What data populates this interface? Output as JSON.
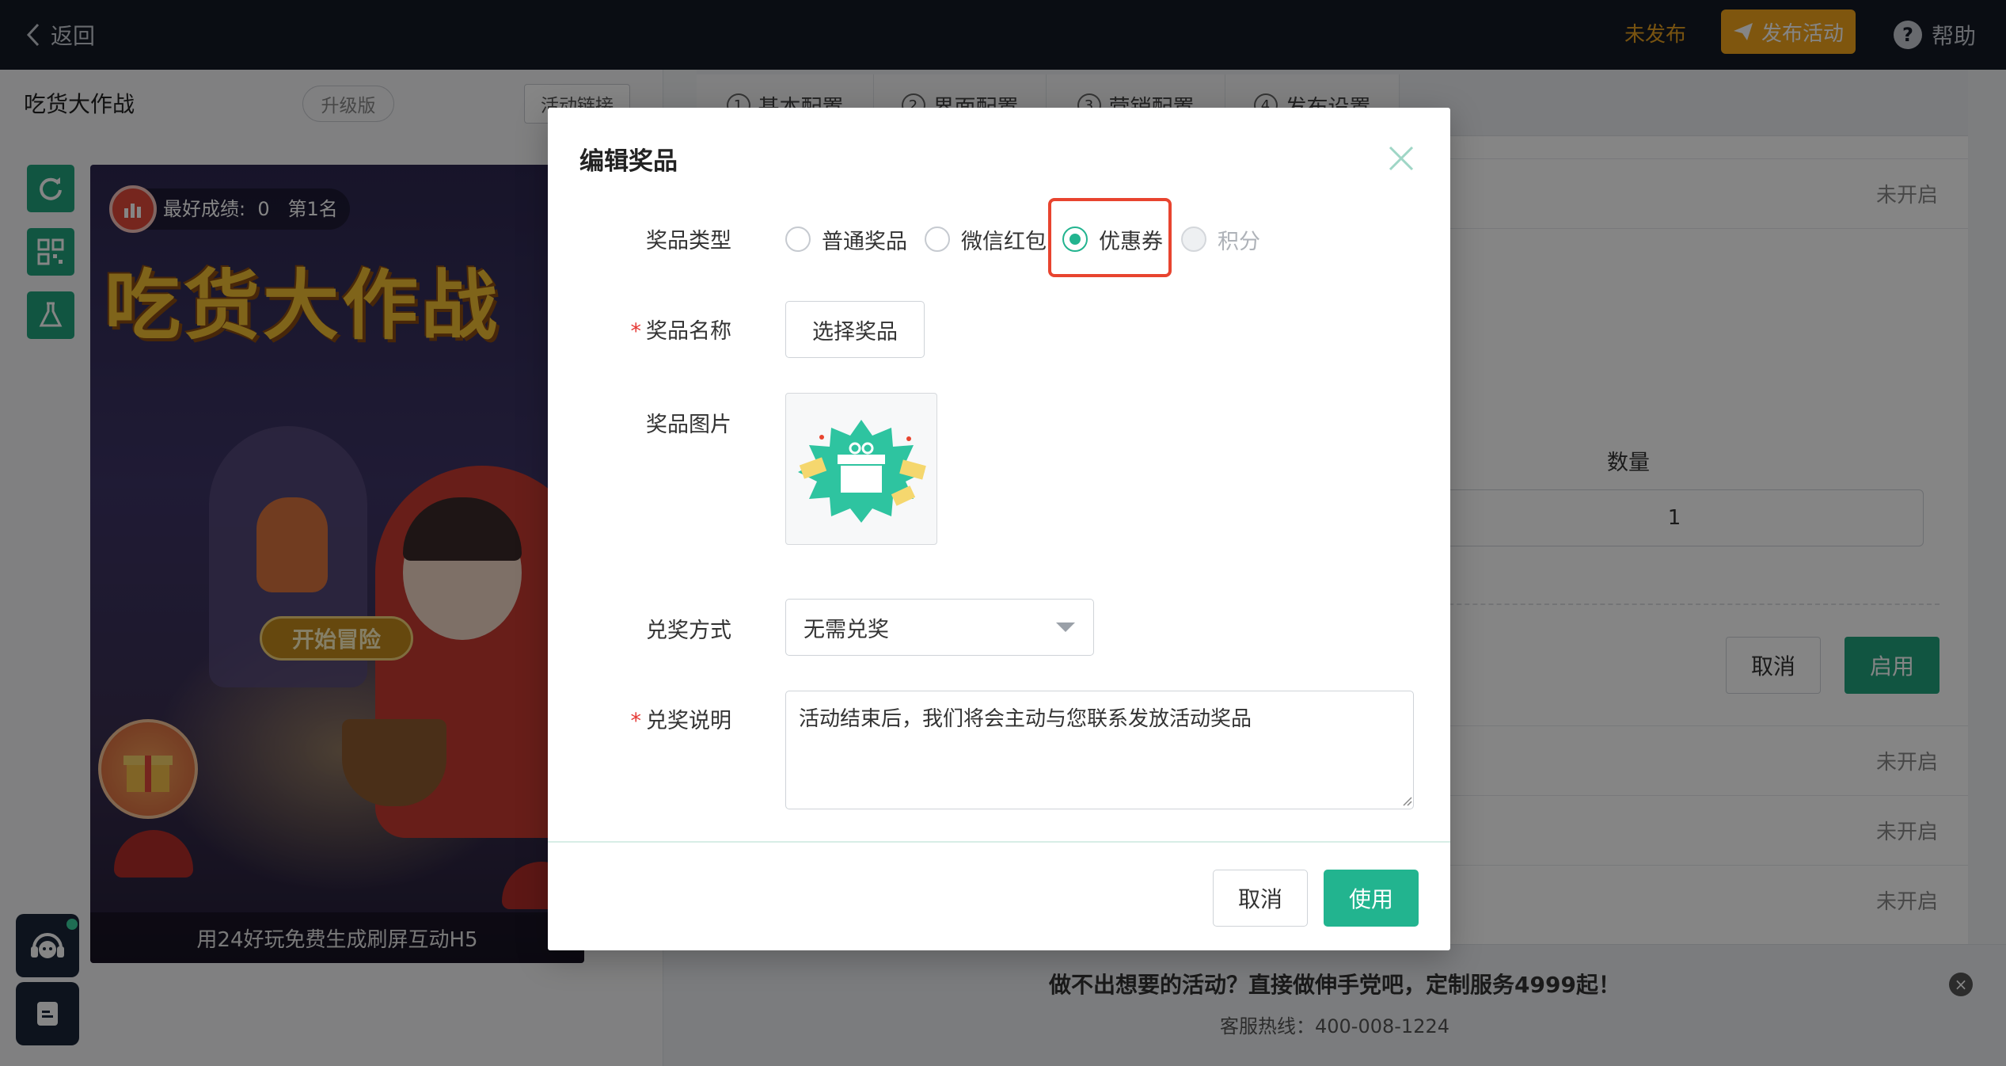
{
  "topbar": {
    "back_label": "返回",
    "status_label": "未发布",
    "publish_label": "发布活动",
    "help_label": "帮助"
  },
  "project": {
    "title": "吃货大作战",
    "version_badge": "升级版",
    "link_label": "活动链接"
  },
  "preview": {
    "score_label": "最好成绩:",
    "score_value": "0",
    "rank_label": "第1名",
    "game_title": "吃货大作战",
    "start_label": "开始冒险",
    "caption": "用24好玩免费生成刷屏互动H5"
  },
  "tabs": [
    {
      "num": "1",
      "label": "基本配置"
    },
    {
      "num": "2",
      "label": "界面配置"
    },
    {
      "num": "3",
      "label": "营销配置"
    },
    {
      "num": "4",
      "label": "发布设置"
    }
  ],
  "right": {
    "status_off": "未开启",
    "qty_label": "数量",
    "qty_value": "1",
    "cancel_label": "取消",
    "enable_label": "启用"
  },
  "banner": {
    "main": "做不出想要的活动？直接做伸手党吧，定制服务4999起！",
    "phone": "客服热线：400-008-1224"
  },
  "modal": {
    "title": "编辑奖品",
    "type_label": "奖品类型",
    "type_options": [
      "普通奖品",
      "微信红包",
      "优惠券",
      "积分"
    ],
    "selected_type": "优惠券",
    "name_label": "奖品名称",
    "choose_label": "选择奖品",
    "image_label": "奖品图片",
    "redeem_label": "兑奖方式",
    "redeem_value": "无需兑奖",
    "desc_label": "兑奖说明",
    "desc_value": "活动结束后，我们将会主动与您联系发放活动奖品",
    "cancel_label": "取消",
    "use_label": "使用"
  },
  "colors": {
    "accent": "#22b48f",
    "publish": "#f3a61b",
    "highlight": "#e8442f",
    "topbar": "#141a26"
  }
}
